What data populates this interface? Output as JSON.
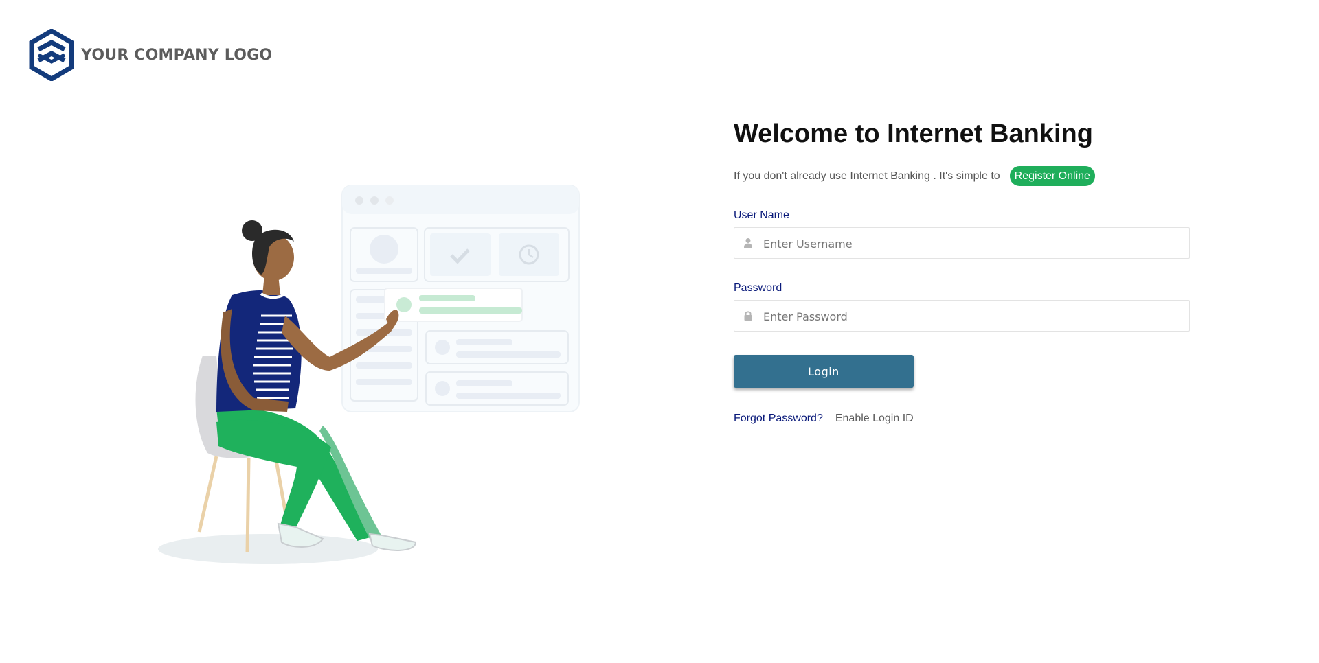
{
  "brand": {
    "logo_text": "YOUR COMPANY LOGO",
    "logo_color": "#133b7c"
  },
  "login": {
    "title": "Welcome to Internet Banking",
    "intro_text": "If you don't already use Internet Banking . It's simple to",
    "register_label": "Register Online",
    "register_color": "#1fae5b",
    "username": {
      "label": "User Name",
      "placeholder": "Enter Username",
      "value": "",
      "icon": "user-icon"
    },
    "password": {
      "label": "Password",
      "placeholder": "Enter Password",
      "value": "",
      "icon": "lock-icon"
    },
    "login_label": "Login",
    "login_color": "#33708f",
    "forgot_label": "Forgot Password?",
    "enable_label": "Enable Login ID"
  },
  "illustration": {
    "subject": "woman-seated-on-chair-illustration",
    "colors": {
      "shirt": "#13277a",
      "pants": "#1fb15c",
      "skin": "#9c6b43",
      "chair": "#ead1a8"
    }
  }
}
